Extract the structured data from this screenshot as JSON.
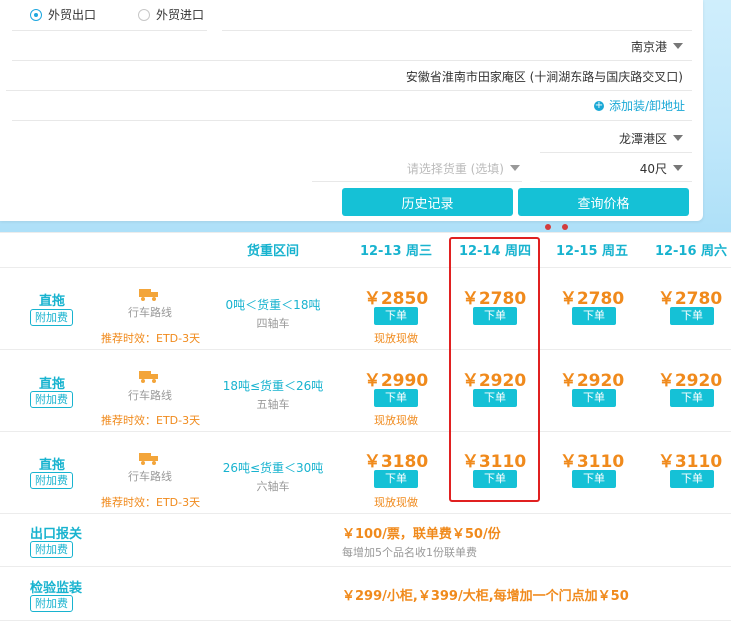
{
  "form": {
    "radio_export": "外贸出口",
    "radio_import": "外贸进口",
    "port": "南京港",
    "address": "安徽省淮南市田家庵区 (十涧湖东路与国庆路交叉口)",
    "add_fee_link": "添加装/卸地址",
    "district": "龙潭港区",
    "cargo_placeholder": "请选择货重 (选填)",
    "container": "40尺",
    "history_btn": "历史记录",
    "query_btn": "查询价格"
  },
  "table": {
    "col_weight": "货重区间",
    "dates": [
      "12-13 周三",
      "12-14 周四",
      "12-15 周五",
      "12-16 周六"
    ],
    "order_label": "下单",
    "now_label": "现放现做",
    "rows": [
      {
        "title": "直拖",
        "tag": "附加费",
        "route": "行车路线",
        "eff": "推荐时效：ETD-3天",
        "range": "0吨＜货重＜18吨",
        "axle": "四轴车",
        "prices": [
          "￥2850",
          "￥2780",
          "￥2780",
          "￥2780"
        ]
      },
      {
        "title": "直拖",
        "tag": "附加费",
        "route": "行车路线",
        "eff": "推荐时效：ETD-3天",
        "range": "18吨≤货重＜26吨",
        "axle": "五轴车",
        "prices": [
          "￥2990",
          "￥2920",
          "￥2920",
          "￥2920"
        ]
      },
      {
        "title": "直拖",
        "tag": "附加费",
        "route": "行车路线",
        "eff": "推荐时效：ETD-3天",
        "range": "26吨≤货重＜30吨",
        "axle": "六轴车",
        "prices": [
          "￥3180",
          "￥3110",
          "￥3110",
          "￥3110"
        ]
      }
    ],
    "customs": {
      "title": "出口报关",
      "tag": "附加费",
      "fee": "￥100/票，联单费￥50/份",
      "note": "每增加5个品名收1份联单费"
    },
    "inspection": {
      "title": "检验监装",
      "tag": "附加费",
      "fee": "￥299/小柜,￥399/大柜,每增加一个门点加￥50"
    }
  },
  "colors": {
    "accent": "#15c1d6",
    "price": "#f08a1c",
    "highlight": "#e02020"
  }
}
